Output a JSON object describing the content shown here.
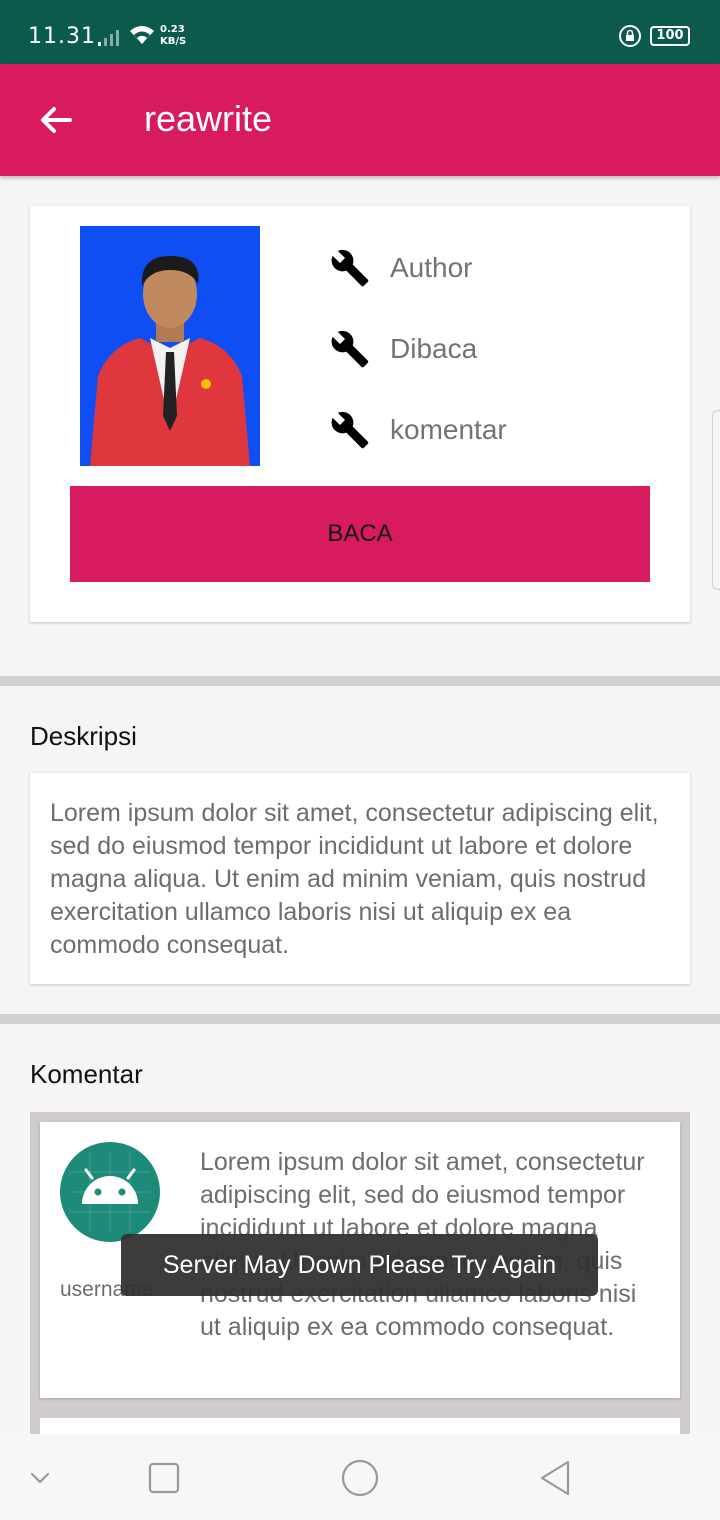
{
  "status_bar": {
    "time": "11.31",
    "speed_value": "0.23",
    "speed_unit": "KB/S",
    "battery": "100"
  },
  "app_bar": {
    "title": "reawrite",
    "back_icon": "arrow-back-icon"
  },
  "profile": {
    "stats": [
      {
        "icon": "wrench-icon",
        "label": "Author"
      },
      {
        "icon": "wrench-icon",
        "label": "Dibaca"
      },
      {
        "icon": "wrench-icon",
        "label": "komentar"
      }
    ],
    "read_button": "BACA"
  },
  "description": {
    "title": "Deskripsi",
    "text": "Lorem ipsum dolor sit amet, consectetur adipiscing elit, sed do eiusmod tempor incididunt ut labore et dolore magna aliqua. Ut enim ad minim veniam, quis nostrud exercitation ullamco laboris nisi ut aliquip ex ea commodo consequat."
  },
  "comments": {
    "title": "Komentar",
    "items": [
      {
        "username": "username",
        "text": "Lorem ipsum dolor sit amet, consectetur adipiscing elit, sed do eiusmod tempor incididunt ut labore et dolore magna aliqua. Ut enim ad minim veniam, quis nostrud exercitation ullamco laboris nisi ut aliquip ex ea commodo consequat."
      }
    ]
  },
  "toast": "Server May Down Please Try Again",
  "colors": {
    "primary": "#d81b60",
    "status_bar": "#0c5a4c",
    "photo_background": "#0e4ef3",
    "avatar": "#1e8a7a"
  }
}
